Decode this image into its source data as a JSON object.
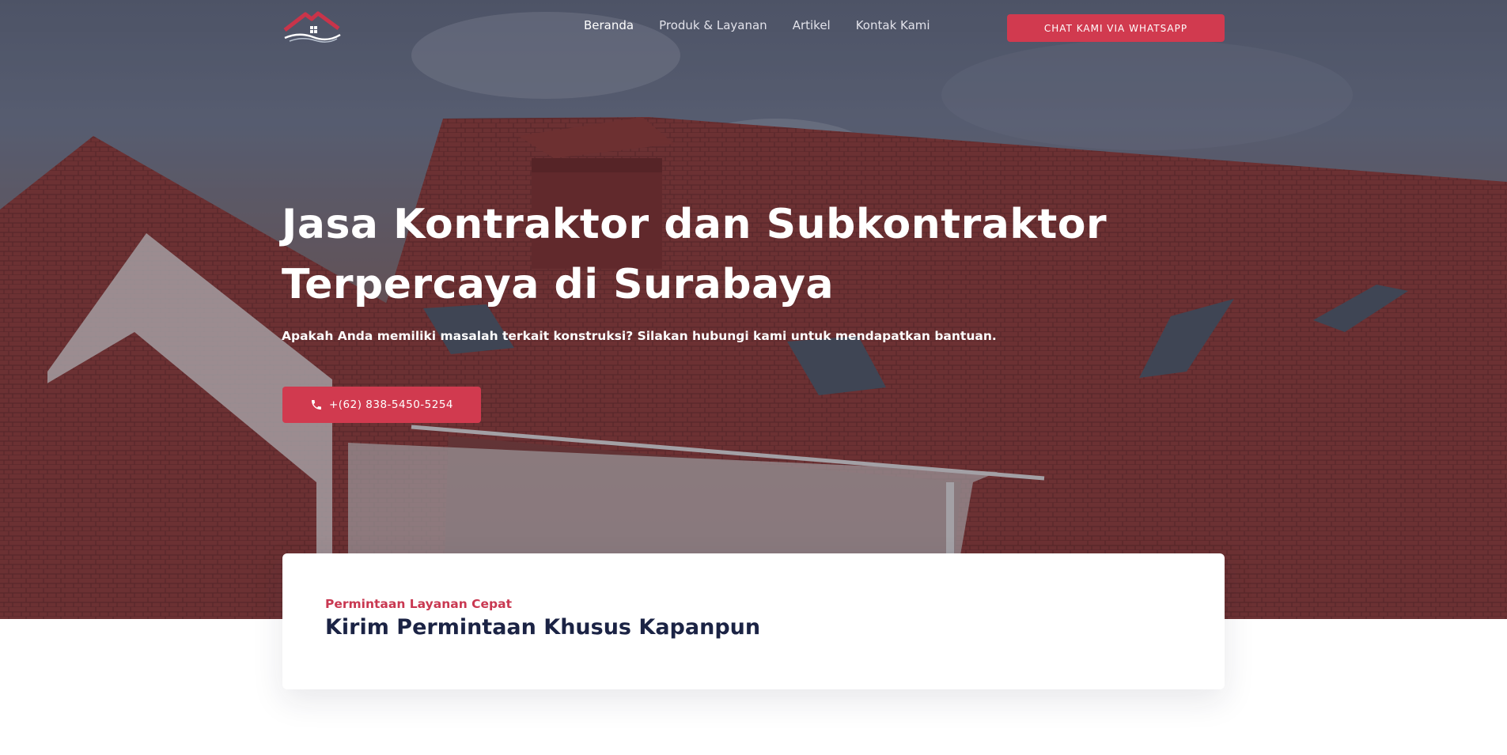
{
  "nav": {
    "items": [
      {
        "label": "Beranda",
        "active": true
      },
      {
        "label": "Produk & Layanan",
        "active": false
      },
      {
        "label": "Artikel",
        "active": false
      },
      {
        "label": "Kontak Kami",
        "active": false
      }
    ],
    "cta_label": "CHAT KAMI VIA WHATSAPP"
  },
  "hero": {
    "title_line1": "Jasa Kontraktor dan Subkontraktor",
    "title_line2": "Terpercaya di Surabaya",
    "subtitle": "Apakah Anda memiliki masalah terkait konstruksi? Silakan hubungi kami untuk mendapatkan bantuan.",
    "phone_label": "+(62) 838-5450-5254",
    "phone_icon": "phone-icon"
  },
  "request_card": {
    "eyebrow": "Permintaan Layanan Cepat",
    "title": "Kirim Permintaan Khusus Kapanpun"
  },
  "colors": {
    "accent": "#d13a4f",
    "eyebrow": "#c93851",
    "heading_dark": "#1b2344"
  },
  "logo_icon": "house-roof-logo-icon"
}
